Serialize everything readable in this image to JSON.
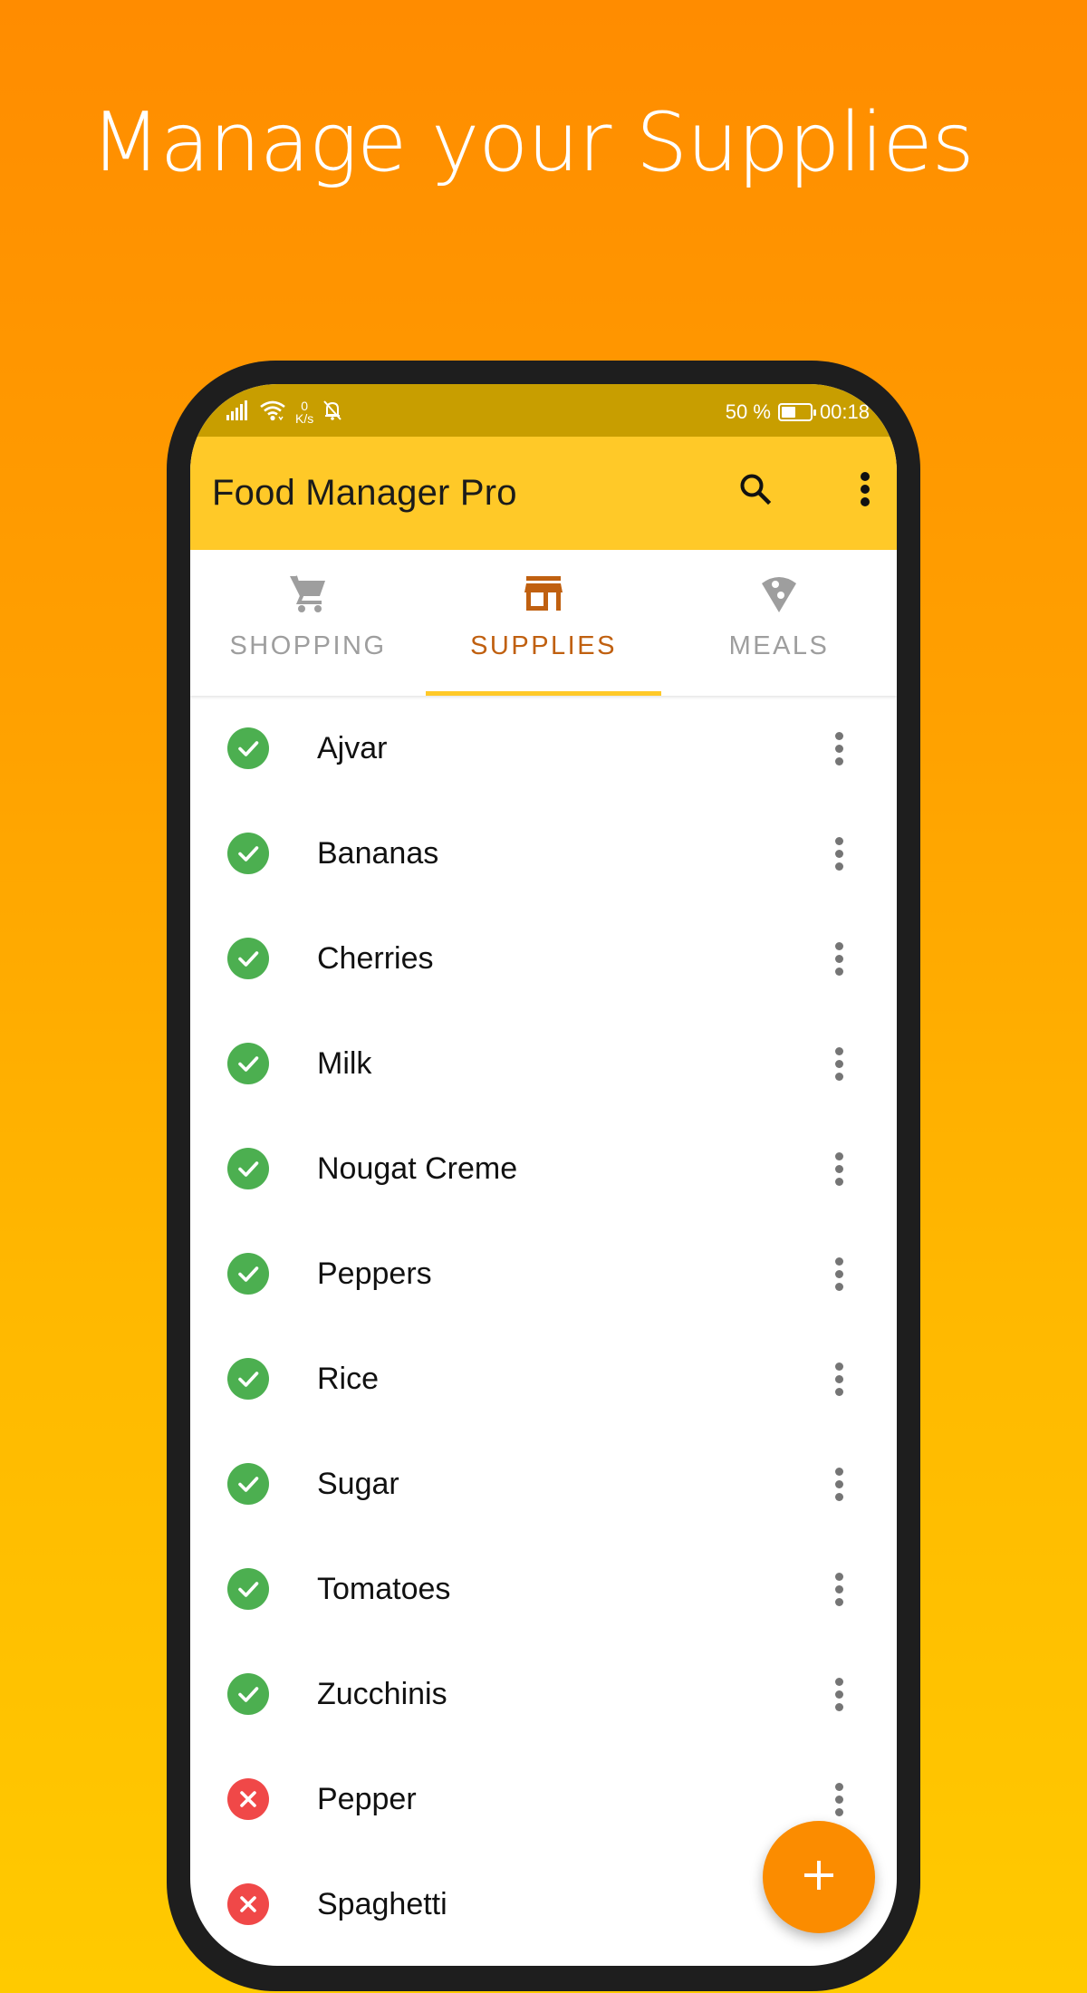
{
  "headline": "Manage your Supplies",
  "status_bar": {
    "net_speed_value": "0",
    "net_speed_unit": "K/s",
    "battery_percent_text": "50 %",
    "battery_level": 0.5,
    "time": "00:18",
    "icons": [
      "signal-icon",
      "wifi-icon",
      "notifications-off-icon",
      "battery-icon"
    ]
  },
  "app_bar": {
    "title": "Food Manager Pro",
    "actions": [
      "search-icon",
      "more-vert-icon"
    ]
  },
  "tabs": [
    {
      "label": "SHOPPING",
      "icon": "shopping-cart-icon",
      "active": false
    },
    {
      "label": "SUPPLIES",
      "icon": "store-icon",
      "active": true
    },
    {
      "label": "MEALS",
      "icon": "pizza-slice-icon",
      "active": false
    }
  ],
  "supplies": [
    {
      "name": "Ajvar",
      "in_stock": true
    },
    {
      "name": "Bananas",
      "in_stock": true
    },
    {
      "name": "Cherries",
      "in_stock": true
    },
    {
      "name": "Milk",
      "in_stock": true
    },
    {
      "name": "Nougat Creme",
      "in_stock": true
    },
    {
      "name": "Peppers",
      "in_stock": true
    },
    {
      "name": "Rice",
      "in_stock": true
    },
    {
      "name": "Sugar",
      "in_stock": true
    },
    {
      "name": "Tomatoes",
      "in_stock": true
    },
    {
      "name": "Zucchinis",
      "in_stock": true
    },
    {
      "name": "Pepper",
      "in_stock": false
    },
    {
      "name": "Spaghetti",
      "in_stock": false
    }
  ],
  "fab": {
    "icon": "add-icon"
  },
  "colors": {
    "background_top": "#FF8C00",
    "background_bottom": "#FFCA00",
    "status_bar": "#C89E00",
    "app_bar": "#FFC928",
    "active_tab": "#C06010",
    "inactive_tab": "#9E9E9E",
    "in_stock": "#4CAF50",
    "out_of_stock": "#F04848",
    "fab": "#FB8C00"
  }
}
